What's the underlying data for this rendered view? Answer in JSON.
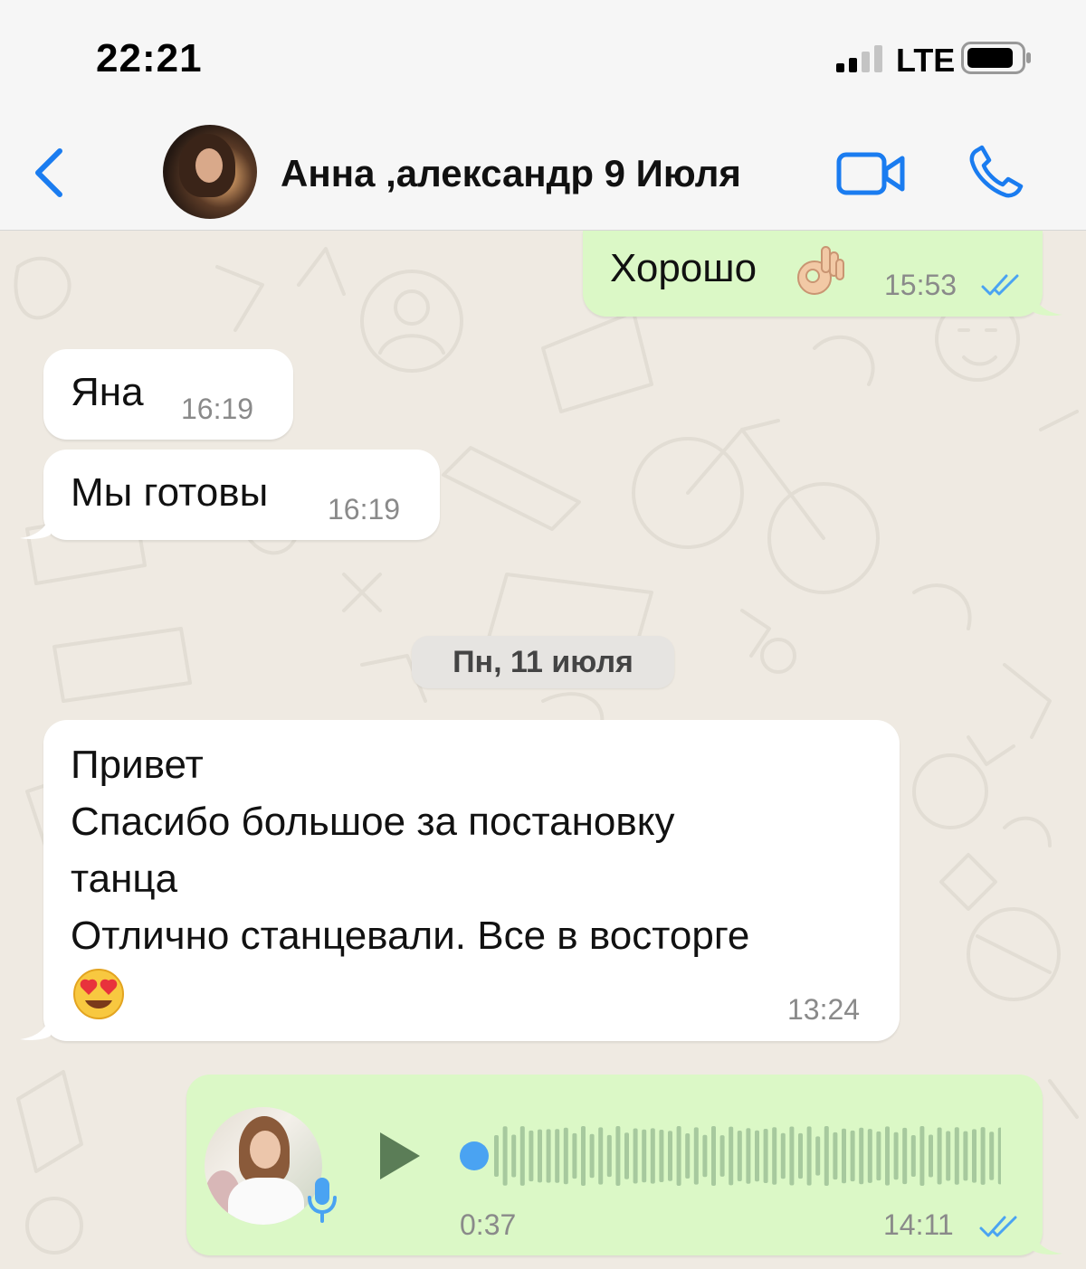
{
  "status_bar": {
    "time": "22:21",
    "network": "LTE"
  },
  "header": {
    "back_icon": "chevron-left-icon",
    "title": "Анна ,александр 9 Июля",
    "video_icon": "video-camera-icon",
    "phone_icon": "phone-icon",
    "accent": "#1a7cf0"
  },
  "messages": [
    {
      "direction": "out",
      "text": "Хорошо",
      "emoji": "ok-hand",
      "time": "15:53",
      "status": "read"
    },
    {
      "direction": "in",
      "text": "Яна",
      "time": "16:19"
    },
    {
      "direction": "in",
      "text": "Мы готовы",
      "time": "16:19"
    },
    {
      "direction": "in",
      "text": "Привет\nСпасибо большое за постановку\nтанца\nОтлично станцевали. Все в восторге",
      "emoji": "heart-eyes",
      "time": "13:24"
    },
    {
      "direction": "out",
      "type": "voice",
      "duration": "0:37",
      "time": "14:11",
      "status": "read",
      "progress": 0
    }
  ],
  "date_separator": "Пн, 11 июля",
  "colors": {
    "incoming_bubble": "#ffffff",
    "outgoing_bubble": "#dbf8c6",
    "chat_background": "#efeae2",
    "read_ticks": "#4aa3f2"
  }
}
